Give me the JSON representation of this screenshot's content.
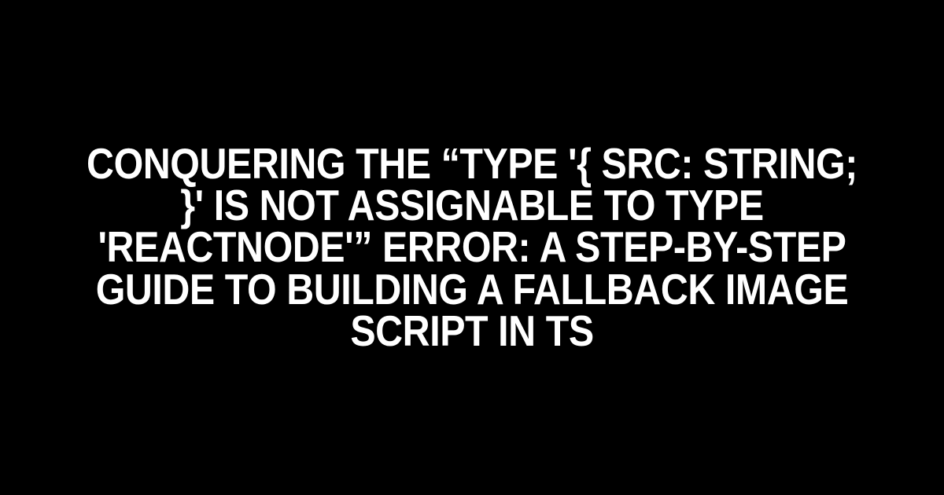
{
  "title": "Conquering the “Type '{ src: string; }' is not assignable to type 'ReactNode'” Error: A Step-by-Step Guide to Building a Fallback Image Script in TS"
}
